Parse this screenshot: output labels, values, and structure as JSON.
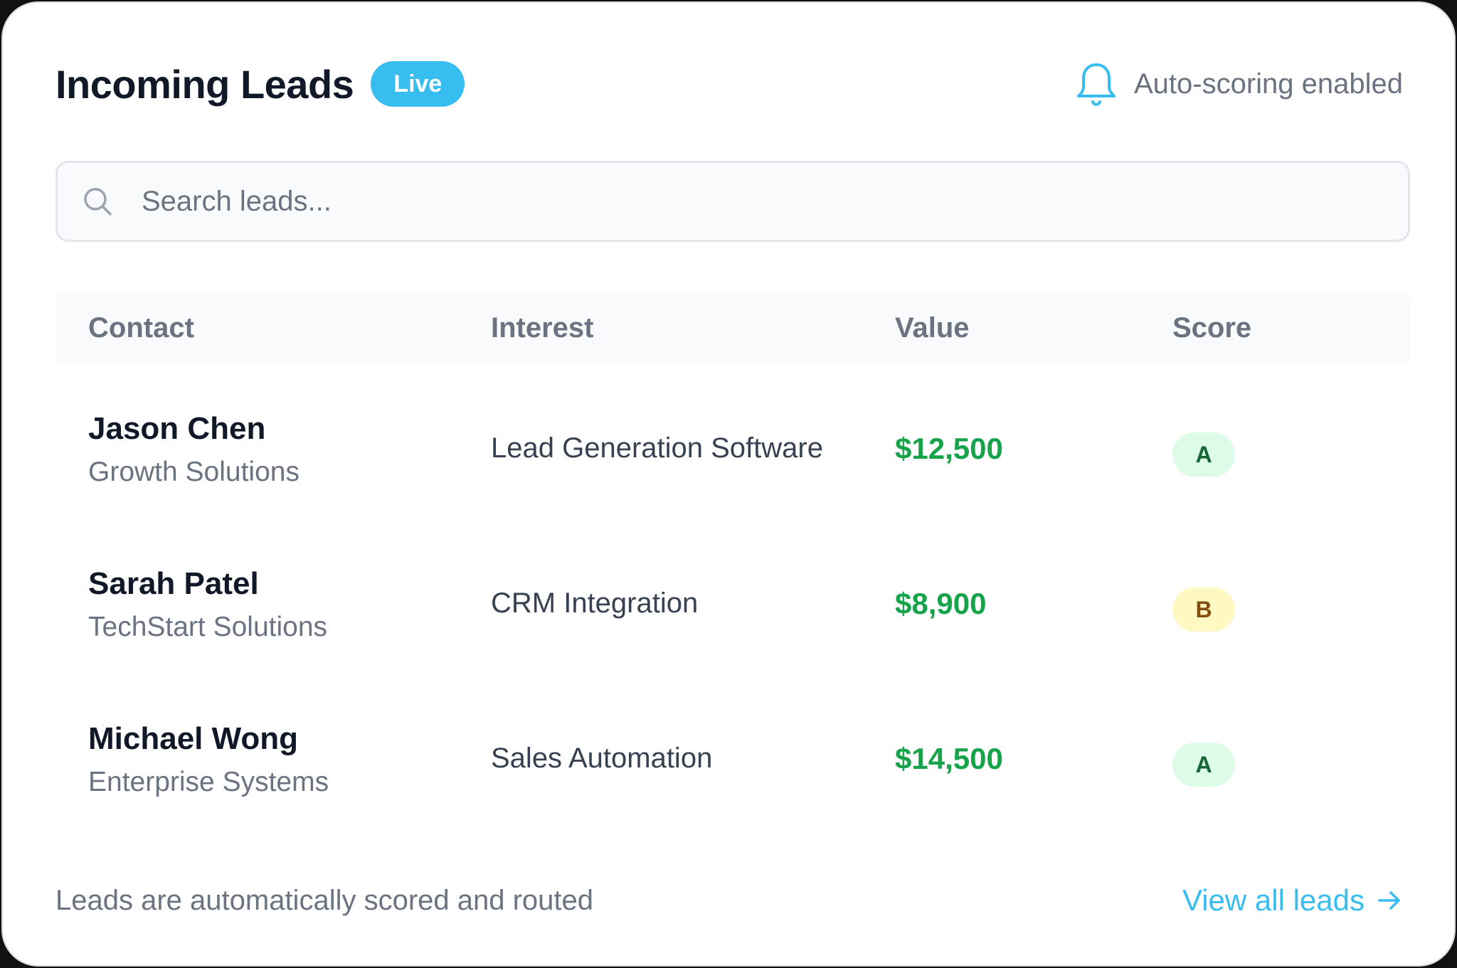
{
  "header": {
    "title": "Incoming Leads",
    "live_badge": "Live",
    "status_text": "Auto-scoring enabled",
    "status_icon": "bell-icon"
  },
  "search": {
    "placeholder": "Search leads...",
    "value": "",
    "icon": "search-icon"
  },
  "table": {
    "columns": [
      "Contact",
      "Interest",
      "Value",
      "Score"
    ],
    "rows": [
      {
        "name": "Jason Chen",
        "company": "Growth Solutions",
        "interest": "Lead Generation Software",
        "value": "$12,500",
        "score": "A"
      },
      {
        "name": "Sarah Patel",
        "company": "TechStart Solutions",
        "interest": "CRM Integration",
        "value": "$8,900",
        "score": "B"
      },
      {
        "name": "Michael Wong",
        "company": "Enterprise Systems",
        "interest": "Sales Automation",
        "value": "$14,500",
        "score": "A"
      }
    ]
  },
  "footer": {
    "note": "Leads are automatically scored and routed",
    "view_all_label": "View all leads",
    "view_all_icon": "arrow-right-icon"
  },
  "colors": {
    "accent": "#38bdf0",
    "value_green": "#16a34a",
    "score_a_bg": "#dcfce7",
    "score_a_text": "#166534",
    "score_b_bg": "#fef9c3",
    "score_b_text": "#854d0e"
  }
}
